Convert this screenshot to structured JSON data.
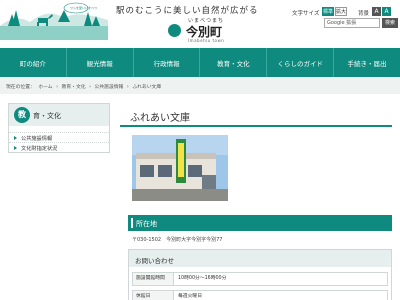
{
  "header": {
    "tagline": "駅のむこうに美しい自然が広がる",
    "logo_kana": "いまべつまち",
    "logo_name": "今別町",
    "logo_en": "Imabetsu town",
    "mascot_text": "ワシを愛いいまべつ",
    "font_label": "文字サイズ",
    "font_std": "標準",
    "font_large": "拡大",
    "bg_label": "背景",
    "size_a_small": "A",
    "size_a_large": "A",
    "search_placeholder": "Google 拡張",
    "search_button": "検索"
  },
  "nav": [
    "町の紹介",
    "観光情報",
    "行政情報",
    "教育・文化",
    "くらしのガイド",
    "手続き・届出"
  ],
  "breadcrumb": [
    "現在の位置：",
    "ホーム",
    "›",
    "教育・文化",
    "›",
    "公共施設情報",
    "›",
    "ふれあい文庫"
  ],
  "sidebar": {
    "icon_char": "教",
    "title": "育・文化",
    "items": [
      "公共施設情報",
      "文化財指定状況"
    ]
  },
  "main": {
    "title": "ふれあい文庫",
    "location_heading": "所在地",
    "location_text": "〒030-1502　今別町大字今別字今別77",
    "contact_heading": "お問い合わせ",
    "rows": [
      {
        "label": "施設開館時間",
        "value": "10時00分～16時00分"
      },
      {
        "label": "休館日",
        "value": "毎週火曜日"
      }
    ]
  },
  "colors": {
    "accent": "#0e8a7e",
    "nav_bg": "#0e8a7e",
    "crumb_bg": "#eef2f1"
  }
}
